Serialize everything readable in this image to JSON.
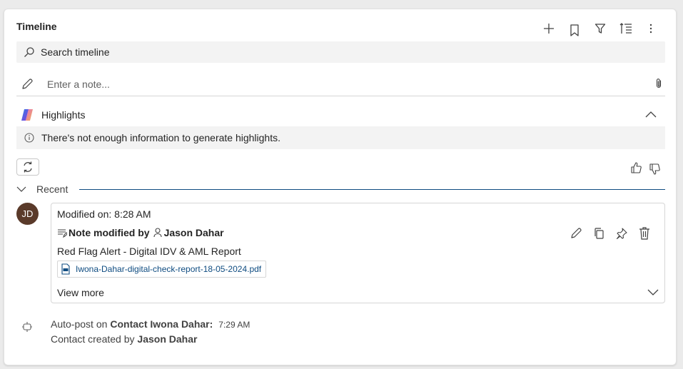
{
  "timeline": {
    "title": "Timeline",
    "toolbar": [
      "add-icon",
      "bookmark-icon",
      "filter-icon",
      "sort-icon",
      "more-icon"
    ]
  },
  "search": {
    "placeholder": "Search timeline"
  },
  "note": {
    "placeholder": "Enter a note..."
  },
  "highlights": {
    "label": "Highlights",
    "info": "There's not enough information to generate highlights."
  },
  "recent": {
    "label": "Recent"
  },
  "activity": {
    "avatar_initials": "JD",
    "avatar_color": "#5a3a2a",
    "modified": "Modified on: 8:28 AM",
    "action_prefix": "Note modified by",
    "author": "Jason Dahar",
    "subject": "Red Flag Alert - Digital IDV & AML Report",
    "attachment": "Iwona-Dahar-digital-check-report-18-05-2024.pdf",
    "view_more": "View more"
  },
  "autopost": {
    "prefix": "Auto-post on",
    "contact": "Contact Iwona Dahar:",
    "time": "7:29 AM",
    "line2_prefix": "Contact created by",
    "line2_author": "Jason Dahar"
  },
  "colors": {
    "accent_line": "#0f4c81",
    "link": "#0f4c81"
  }
}
